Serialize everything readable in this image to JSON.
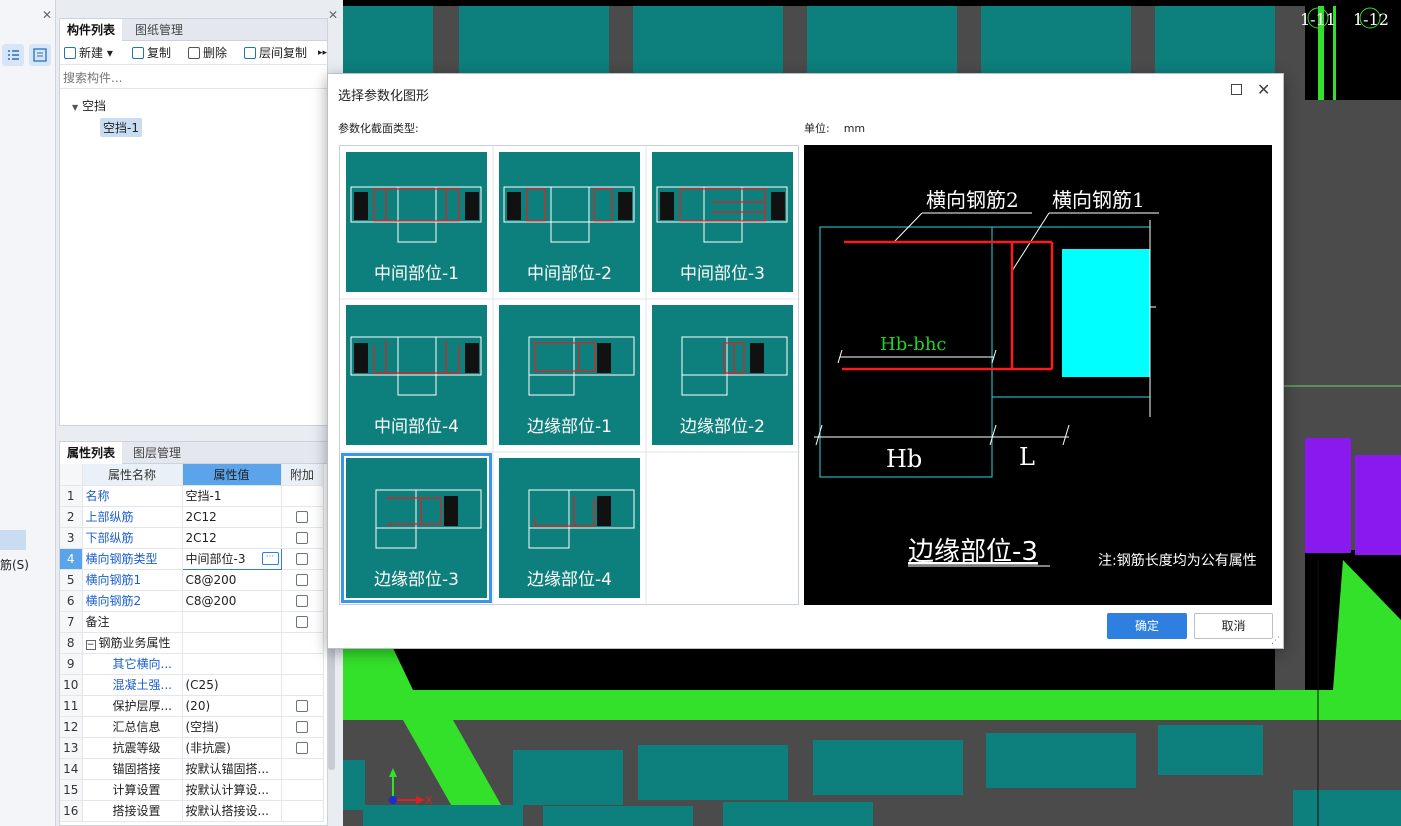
{
  "left_panel": {
    "tabs": [
      "构件列表",
      "图纸管理"
    ],
    "toolbar": {
      "new": "新建",
      "copy": "复制",
      "delete": "删除",
      "floor_copy": "层间复制"
    },
    "search_placeholder": "搜索构件...",
    "tree": {
      "root": "空挡",
      "child": "空挡-1"
    },
    "side_text": "筋(S)"
  },
  "prop_panel": {
    "tabs": [
      "属性列表",
      "图层管理"
    ],
    "headers": {
      "name": "属性名称",
      "value": "属性值",
      "extra": "附加"
    },
    "rows": [
      {
        "n": "1",
        "name": "名称",
        "value": "空挡-1"
      },
      {
        "n": "2",
        "name": "上部纵筋",
        "value": "2C12"
      },
      {
        "n": "3",
        "name": "下部纵筋",
        "value": "2C12"
      },
      {
        "n": "4",
        "name": "横向钢筋类型",
        "value": "中间部位-3"
      },
      {
        "n": "5",
        "name": "横向钢筋1",
        "value": "C8@200"
      },
      {
        "n": "6",
        "name": "横向钢筋2",
        "value": "C8@200"
      },
      {
        "n": "7",
        "name": "备注",
        "value": ""
      },
      {
        "n": "8",
        "name": "钢筋业务属性",
        "value": ""
      },
      {
        "n": "9",
        "name": "其它横向...",
        "value": ""
      },
      {
        "n": "10",
        "name": "混凝土强...",
        "value": "(C25)"
      },
      {
        "n": "11",
        "name": "保护层厚...",
        "value": "(20)"
      },
      {
        "n": "12",
        "name": "汇总信息",
        "value": "(空挡)"
      },
      {
        "n": "13",
        "name": "抗震等级",
        "value": "(非抗震)"
      },
      {
        "n": "14",
        "name": "锚固搭接",
        "value": "按默认锚固搭..."
      },
      {
        "n": "15",
        "name": "计算设置",
        "value": "按默认计算设..."
      },
      {
        "n": "16",
        "name": "搭接设置",
        "value": "按默认搭接设..."
      }
    ]
  },
  "cad": {
    "axis_labels": [
      "1-11",
      "1-12"
    ],
    "x_axis": "X"
  },
  "dialog": {
    "title": "选择参数化图形",
    "section_label": "参数化截面类型:",
    "unit_label": "单位:",
    "unit_value": "mm",
    "options": [
      "中间部位-1",
      "中间部位-2",
      "中间部位-3",
      "中间部位-4",
      "边缘部位-1",
      "边缘部位-2",
      "边缘部位-3",
      "边缘部位-4"
    ],
    "selected": "边缘部位-3",
    "preview": {
      "label_rebar2": "横向钢筋2",
      "label_rebar1": "横向钢筋1",
      "dim_hb_bhc": "Hb-bhc",
      "dim_hb": "Hb",
      "dim_l": "L",
      "title": "边缘部位-3",
      "note": "注:钢筋长度均为公有属性"
    },
    "ok": "确定",
    "cancel": "取消"
  },
  "colors": {
    "teal": "#0d7f7c",
    "accent": "#2f7fe0",
    "green": "#33e12a",
    "purple": "#8a19f0"
  }
}
